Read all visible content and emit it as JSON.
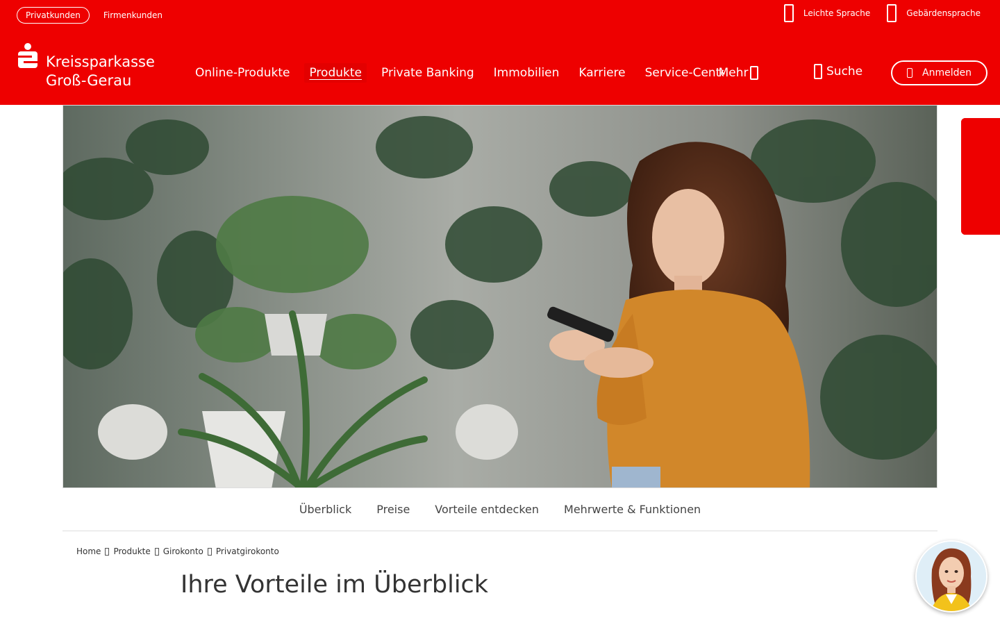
{
  "segments": {
    "private": "Privatkunden",
    "business": "Firmenkunden"
  },
  "accessibility": {
    "easy_language": "Leichte Sprache",
    "sign_language": "Gebärdensprache"
  },
  "logo": {
    "line1": "Kreissparkasse",
    "line2": "Groß-Gerau"
  },
  "nav": {
    "items": [
      "Online-Produkte",
      "Produkte",
      "Private Banking",
      "Immobilien",
      "Karriere",
      "Service-Center"
    ],
    "active": "Produkte",
    "more": "Mehr"
  },
  "search": {
    "label": "Suche"
  },
  "login": {
    "label": "Anmelden"
  },
  "subnav": {
    "items": [
      "Überblick",
      "Preise",
      "Vorteile entdecken",
      "Mehrwerte & Funktionen"
    ]
  },
  "breadcrumb": {
    "items": [
      "Home",
      "Produkte",
      "Girokonto",
      "Privatgirokonto"
    ]
  },
  "page_title": "Ihre Vorteile im Überblick",
  "colors": {
    "brand_red": "#ee0000",
    "online_green": "#1a9d3e"
  }
}
